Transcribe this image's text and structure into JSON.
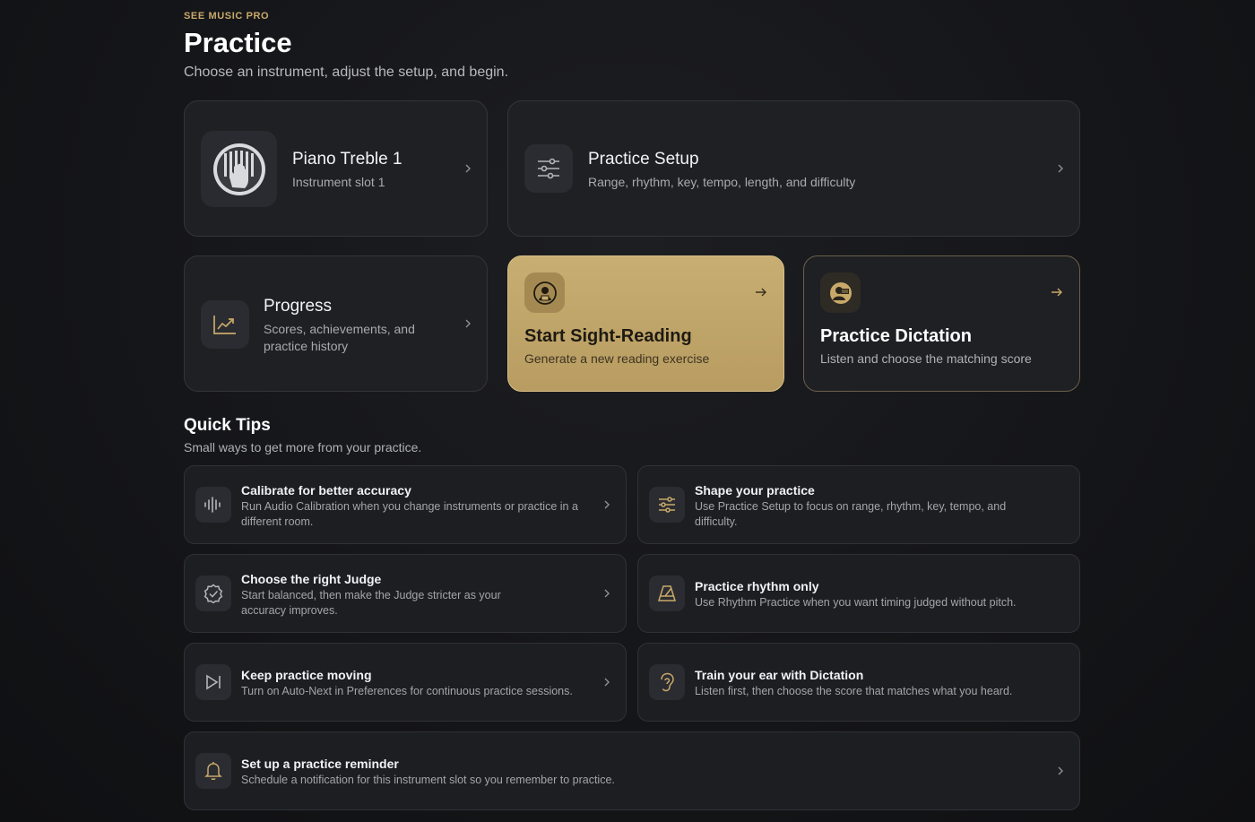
{
  "header": {
    "eyebrow": "SEE MUSIC PRO",
    "title": "Practice",
    "subtitle": "Choose an instrument, adjust the setup, and begin."
  },
  "instrument_card": {
    "title": "Piano Treble 1",
    "subtitle": "Instrument slot 1",
    "icon": "piano-hand-icon"
  },
  "setup_card": {
    "title": "Practice Setup",
    "subtitle": "Range, rhythm, key, tempo, length, and difficulty",
    "icon": "sliders-icon"
  },
  "progress_card": {
    "title": "Progress",
    "subtitle_line1": "Scores, achievements, and",
    "subtitle_line2": "practice history",
    "icon": "chart-line-icon"
  },
  "sight_reading_card": {
    "title": "Start Sight-Reading",
    "subtitle": "Generate a new reading exercise",
    "icon": "reader-icon"
  },
  "dictation_card": {
    "title": "Practice Dictation",
    "subtitle": "Listen and choose the matching score",
    "icon": "listener-icon"
  },
  "quick_tips": {
    "title": "Quick Tips",
    "subtitle": "Small ways to get more from your practice.",
    "items": [
      {
        "title": "Calibrate for better accuracy",
        "line1": "Run Audio Calibration when you change instruments or practice in a",
        "line2": "different room.",
        "icon": "waveform-icon"
      },
      {
        "title": "Shape your practice",
        "line1": "Use Practice Setup to focus on range, rhythm, key, tempo, and",
        "line2": "difficulty.",
        "icon": "sliders-icon"
      },
      {
        "title": "Choose the right Judge",
        "line1": "Start balanced, then make the Judge stricter as your",
        "line2": "accuracy improves.",
        "icon": "badge-check-icon"
      },
      {
        "title": "Practice rhythm only",
        "line1": "Use Rhythm Practice when you want timing judged without pitch.",
        "line2": "",
        "icon": "metronome-icon"
      },
      {
        "title": "Keep practice moving",
        "line1": "Turn on Auto-Next in Preferences for continuous practice sessions.",
        "line2": "",
        "icon": "skip-forward-icon"
      },
      {
        "title": "Train your ear with Dictation",
        "line1": "Listen first, then choose the score that matches what you heard.",
        "line2": "",
        "icon": "ear-icon"
      },
      {
        "title": "Set up a practice reminder",
        "line1": "Schedule a notification for this instrument slot so you remember to practice.",
        "line2": "",
        "icon": "bell-icon"
      }
    ]
  },
  "colors": {
    "accent_gold": "#c8ae72",
    "gold_text": "#c8a96a",
    "card_bg": "#1f2024",
    "page_bg": "#141518"
  }
}
